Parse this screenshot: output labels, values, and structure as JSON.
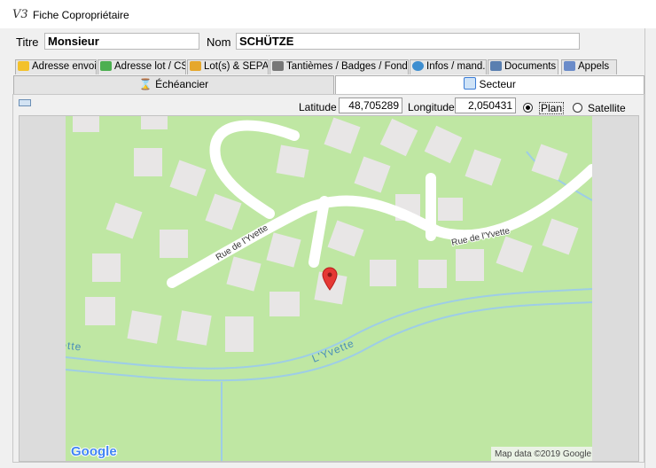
{
  "window": {
    "title": "Fiche Copropriétaire",
    "icon": "V3"
  },
  "header": {
    "titre_label": "Titre",
    "titre_value": "Monsieur",
    "nom_label": "Nom",
    "nom_value": "SCHÜTZE"
  },
  "tabs": [
    {
      "label": "Adresse envoi",
      "icon": "envelope-icon",
      "color": "#f3c12b"
    },
    {
      "label": "Adresse lot / CS",
      "icon": "building-icon",
      "color": "#4caf50"
    },
    {
      "label": "Lot(s) & SEPA",
      "icon": "house-icon",
      "color": "#e5a72c"
    },
    {
      "label": "Tantièmes / Badges / Fonds",
      "icon": "keyboard-icon",
      "color": "#777777"
    },
    {
      "label": "Infos / mand.",
      "icon": "info-icon",
      "color": "#3e8ed0"
    },
    {
      "label": "Documents",
      "icon": "documents-icon",
      "color": "#5a7fb0"
    },
    {
      "label": "Appels",
      "icon": "calculator-icon",
      "color": "#6a8bc9"
    }
  ],
  "subtabs": [
    {
      "label": "Échéancier",
      "icon": "hourglass-icon"
    },
    {
      "label": "Secteur",
      "icon": "map-sector-icon"
    }
  ],
  "location": {
    "latitude_label": "Latitude",
    "latitude_value": "48,705289",
    "longitude_label": "Longitude",
    "longitude_value": "2,050431",
    "plan_label": "Plan",
    "satellite_label": "Satellite",
    "selected": "Plan"
  },
  "map": {
    "street1": "Rue de l'Yvette",
    "street2": "Rue de l'Yvette",
    "river": "L'Yvette",
    "river_fragment": "ette",
    "logo": "Google",
    "attribution": "Map data ©2019 Google",
    "colors": {
      "land": "#bfe7a3",
      "road": "#ffffff",
      "building": "#e8e6e6",
      "water": "#9ecde6",
      "marker": "#e53935"
    }
  }
}
